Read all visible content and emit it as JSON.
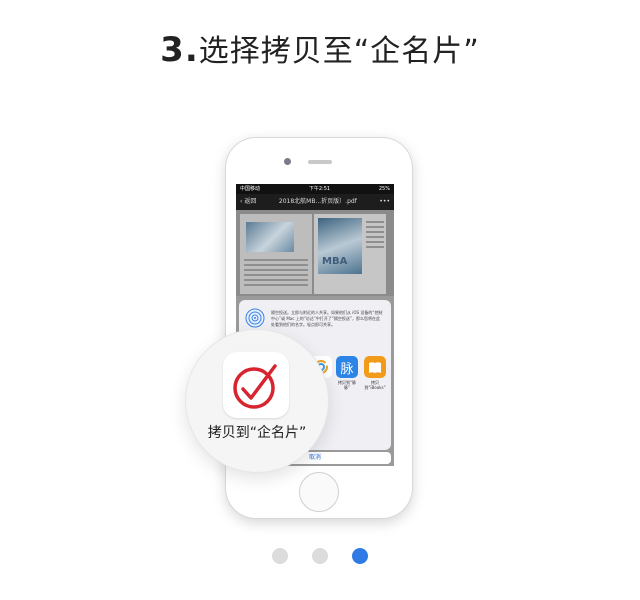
{
  "step": {
    "number": "3.",
    "title": "选择拷贝至“企名片”"
  },
  "phone": {
    "status_left": "中国移动",
    "status_center": "下午2:51",
    "status_right": "25%",
    "nav_back": "返回",
    "nav_title": "2018北航MB...折页版）.pdf",
    "nav_more": "•••",
    "doc_badge": "MBA",
    "airdrop_text": "隔空投送。立即与附近的人共享。如果他们从 iOS 设备的“控制中心”或 Mac 上的“访达”中打开了“隔空投送”，那么您将在此处看到他们的名字。轻点即可共享。",
    "apps": [
      {
        "label": "拷贝到“脉脉”",
        "icon": "maimai-icon",
        "glyph": "脉"
      },
      {
        "label": "拷贝到“iBooks”",
        "icon": "ibooks-icon"
      }
    ],
    "cancel_label": "取消"
  },
  "magnifier": {
    "label": "拷贝到“企名片”",
    "icon": "qimingpian-icon"
  },
  "pagination": {
    "count": 3,
    "active_index": 2
  },
  "colors": {
    "active_dot": "#2f7ae5",
    "inactive_dot": "#dcdcdc",
    "brand_red": "#d8242f"
  }
}
